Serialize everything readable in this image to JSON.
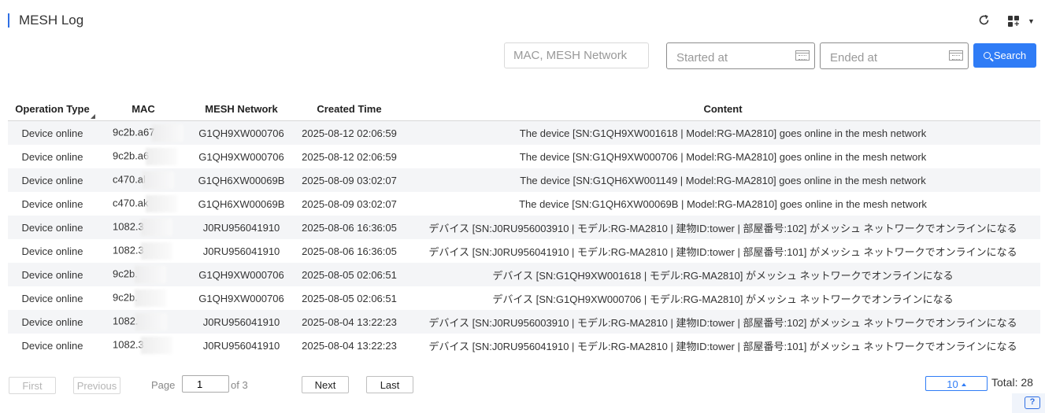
{
  "header": {
    "title": "MESH Log",
    "refresh_icon": "refresh-icon",
    "grid_icon": "grid-add-icon",
    "menu_caret_icon": "caret-down-icon"
  },
  "filters": {
    "search_placeholder": "MAC, MESH Network",
    "start_placeholder": "Started at",
    "end_placeholder": "Ended at",
    "search_label": "Search"
  },
  "table": {
    "columns": [
      "Operation Type",
      "MAC",
      "MESH Network",
      "Created Time",
      "Content"
    ],
    "rows": [
      {
        "type": "Device online",
        "mac": "9c2b.a67",
        "network": "G1QH9XW000706",
        "time": "2025-08-12 02:06:59",
        "content": "The device [SN:G1QH9XW001618 | Model:RG-MA2810] goes online in the mesh network"
      },
      {
        "type": "Device online",
        "mac": "9c2b.a6",
        "network": "G1QH9XW000706",
        "time": "2025-08-12 02:06:59",
        "content": "The device [SN:G1QH9XW000706 | Model:RG-MA2810] goes online in the mesh network"
      },
      {
        "type": "Device online",
        "mac": "c470.al",
        "network": "G1QH6XW00069B",
        "time": "2025-08-09 03:02:07",
        "content": "The device [SN:G1QH6XW001149 | Model:RG-MA2810] goes online in the mesh network"
      },
      {
        "type": "Device online",
        "mac": "c470.ak",
        "network": "G1QH6XW00069B",
        "time": "2025-08-09 03:02:07",
        "content": "The device [SN:G1QH6XW00069B | Model:RG-MA2810] goes online in the mesh network"
      },
      {
        "type": "Device online",
        "mac": "1082.3",
        "network": "J0RU956041910",
        "time": "2025-08-06 16:36:05",
        "content": "デバイス [SN:J0RU956003910 | モデル:RG-MA2810 | 建物ID:tower | 部屋番号:102] がメッシュ ネットワークでオンラインになる"
      },
      {
        "type": "Device online",
        "mac": "1082.3",
        "network": "J0RU956041910",
        "time": "2025-08-06 16:36:05",
        "content": "デバイス [SN:J0RU956041910 | モデル:RG-MA2810 | 建物ID:tower | 部屋番号:101] がメッシュ ネットワークでオンラインになる"
      },
      {
        "type": "Device online",
        "mac": "9c2b.",
        "network": "G1QH9XW000706",
        "time": "2025-08-05 02:06:51",
        "content": "デバイス [SN:G1QH9XW001618 | モデル:RG-MA2810] がメッシュ ネットワークでオンラインになる"
      },
      {
        "type": "Device online",
        "mac": "9c2b.",
        "network": "G1QH9XW000706",
        "time": "2025-08-05 02:06:51",
        "content": "デバイス [SN:G1QH9XW000706 | モデル:RG-MA2810] がメッシュ ネットワークでオンラインになる"
      },
      {
        "type": "Device online",
        "mac": "1082.",
        "network": "J0RU956041910",
        "time": "2025-08-04 13:22:23",
        "content": "デバイス [SN:J0RU956003910 | モデル:RG-MA2810 | 建物ID:tower | 部屋番号:102] がメッシュ ネットワークでオンラインになる"
      },
      {
        "type": "Device online",
        "mac": "1082.3",
        "network": "J0RU956041910",
        "time": "2025-08-04 13:22:23",
        "content": "デバイス [SN:J0RU956041910 | モデル:RG-MA2810 | 建物ID:tower | 部屋番号:101] がメッシュ ネットワークでオンラインになる"
      }
    ]
  },
  "pagination": {
    "first_label": "First",
    "previous_label": "Previous",
    "page_label": "Page",
    "page_value": "1",
    "of_label": "of 3",
    "next_label": "Next",
    "last_label": "Last",
    "page_size": "10",
    "total_label": "Total: 28"
  },
  "colors": {
    "accent": "#2f7cf6",
    "row_stripe": "#f4f5f7"
  }
}
